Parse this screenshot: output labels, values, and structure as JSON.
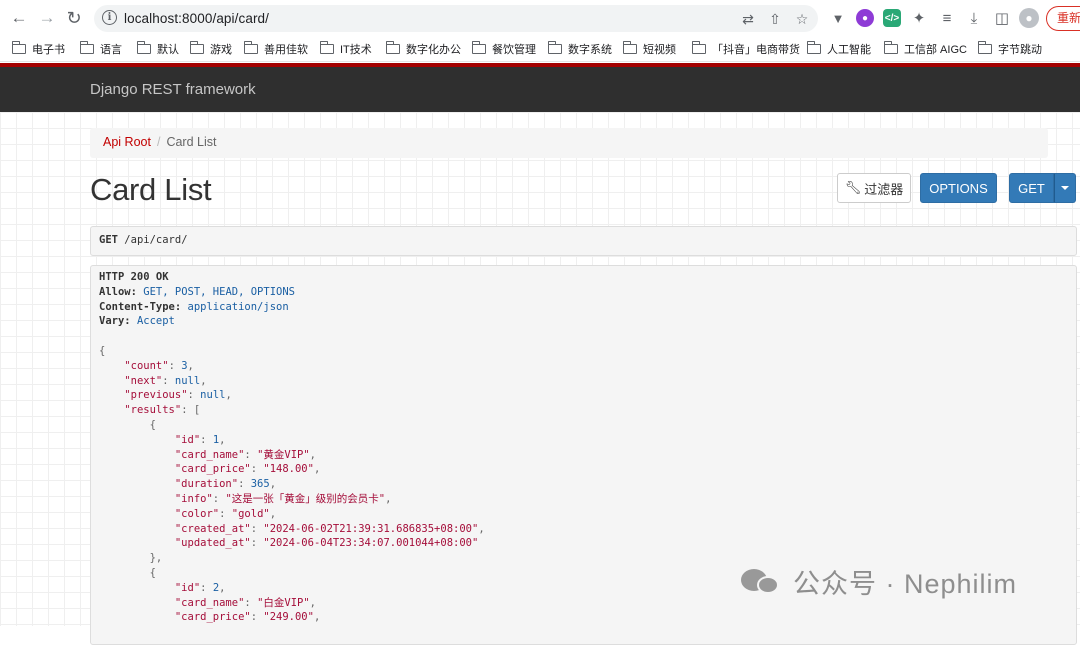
{
  "browser": {
    "url": "localhost:8000/api/card/",
    "relaunch_label": "重新",
    "bookmarks": [
      "电子书",
      "语言",
      "默认",
      "游戏",
      "善用佳软",
      "IT技术",
      "数字化办公",
      "餐饮管理",
      "数字系统",
      "短视频",
      "「抖音」电商带货",
      "人工智能",
      "工信部 AIGC",
      "字节跳动"
    ]
  },
  "navbar": {
    "brand": "Django REST framework"
  },
  "breadcrumb": {
    "root": "Api Root",
    "separator": "/",
    "current": "Card List"
  },
  "page": {
    "title": "Card List",
    "filter_label": "过滤器",
    "options_label": "OPTIONS",
    "get_label": "GET"
  },
  "request": {
    "method": "GET",
    "path": "/api/card/"
  },
  "response": {
    "status": "HTTP 200 OK",
    "headers": [
      {
        "name": "Allow:",
        "value": "GET, POST, HEAD, OPTIONS"
      },
      {
        "name": "Content-Type:",
        "value": "application/json"
      },
      {
        "name": "Vary:",
        "value": "Accept"
      }
    ],
    "body": {
      "count": "3",
      "next": "null",
      "previous": "null",
      "results": [
        {
          "id": "1",
          "card_name": "\"黄金VIP\"",
          "card_price": "\"148.00\"",
          "duration": "365",
          "info": "\"这是一张「黄金」级别的会员卡\"",
          "color": "\"gold\"",
          "created_at": "\"2024-06-02T21:39:31.686835+08:00\"",
          "updated_at": "\"2024-06-04T23:34:07.001044+08:00\""
        },
        {
          "id": "2",
          "card_name": "\"白金VIP\"",
          "card_price": "\"249.00\""
        }
      ]
    }
  },
  "watermark": {
    "text": "公众号 · Nephilim"
  }
}
